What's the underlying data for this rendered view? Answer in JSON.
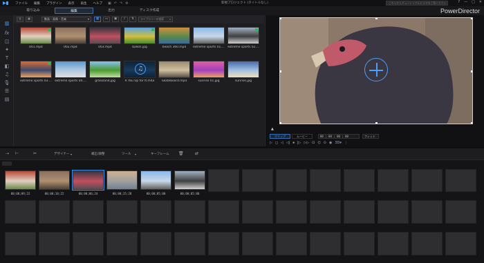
{
  "titlebar": {
    "menu": [
      "ファイル",
      "編集",
      "プラグイン",
      "表示",
      "再生",
      "ヘルプ"
    ],
    "project_title": "新規プロジェクト (タイトルなし)",
    "help_placeholder": "こちらからチュートリアルビデオをご覧ください",
    "window_buttons": [
      "?",
      "—",
      "□",
      "✕"
    ]
  },
  "modes": {
    "capture": "取り込み",
    "edit": "編集",
    "produce": "出力",
    "disc": "ディスク作成"
  },
  "brand": "PowerDirector",
  "library": {
    "dropdown": "動画・画像・音楽",
    "search_placeholder": "ライブラリーの検索",
    "items": [
      {
        "label": "001.mp4",
        "colors": [
          "#b84a3a",
          "#e0d0c0",
          "#6a8a4a"
        ],
        "checked": true
      },
      {
        "label": "002.mp4",
        "colors": [
          "#8a7060",
          "#b09070",
          "#4a4038"
        ],
        "checked": false
      },
      {
        "label": "003.mp4",
        "colors": [
          "#3a3440",
          "#c05060",
          "#5a4a50"
        ],
        "checked": false
      },
      {
        "label": "ballon.jpg",
        "colors": [
          "#5aa0e0",
          "#d0c040",
          "#4a8a30"
        ],
        "checked": true
      },
      {
        "label": "beach 360.mp4",
        "colors": [
          "#d09040",
          "#5a8a4a",
          "#3a6a9a"
        ],
        "checked": false
      },
      {
        "label": "extreme sports 01....",
        "colors": [
          "#8ab8e8",
          "#c8d8e8",
          "#606060"
        ],
        "checked": false
      },
      {
        "label": "extreme sports 02....",
        "colors": [
          "#a0b0c0",
          "#404040",
          "#d0d0d0"
        ],
        "checked": true
      },
      {
        "label": "extreme sports 03....",
        "colors": [
          "#e06a30",
          "#3a4a70",
          "#f0a060"
        ],
        "checked": true
      },
      {
        "label": "extreme sports 04....",
        "colors": [
          "#5a9ad0",
          "#b0c8e0",
          "#e0e0e0"
        ],
        "checked": false
      },
      {
        "label": "grassland.jpg",
        "colors": [
          "#8ac0f0",
          "#4a9a30",
          "#c0e0a0"
        ],
        "checked": false
      },
      {
        "label": "R You Up for It.m4a",
        "colors": [
          "#0d2236",
          "#1a3a5a",
          "#0d2236"
        ],
        "checked": false,
        "music": true
      },
      {
        "label": "Skateboard.mp4",
        "colors": [
          "#9a8a70",
          "#d0c0a0",
          "#5a5048"
        ],
        "checked": false
      },
      {
        "label": "sunrise 01.jpg",
        "colors": [
          "#e060a0",
          "#a040c0",
          "#f0a060"
        ],
        "checked": false
      },
      {
        "label": "sunrise.jpg",
        "colors": [
          "#4a6ab0",
          "#a0c0e0",
          "#f0e0c0"
        ],
        "checked": false
      }
    ]
  },
  "preview": {
    "clip_tab": "クリップ",
    "movie_tab": "ムービー",
    "timecode": "00 ; 00 ; 00 ; 00",
    "fit": "フィット",
    "controls": [
      "▷",
      "◻",
      "◁",
      "◁|",
      "⏹",
      "|▷",
      "▷▷",
      "⊡",
      "⌬",
      "⊙",
      "◉",
      "3D▾",
      "⋮"
    ]
  },
  "timeline_toolbar": {
    "designer": "デザイナー",
    "edit_correct": "補正/調整",
    "tools": "ツール",
    "keyframe": "キーフレーム"
  },
  "storyboard": {
    "clips": [
      {
        "time": "00;00;09;22",
        "colors": [
          "#b84a3a",
          "#e0d0c0",
          "#6a8a4a"
        ]
      },
      {
        "time": "00;00;10;22",
        "colors": [
          "#8a7060",
          "#b09070",
          "#4a4038"
        ]
      },
      {
        "time": "00;00;06;24",
        "colors": [
          "#3a3440",
          "#c05060",
          "#5a4a50"
        ],
        "selected": true
      },
      {
        "time": "00;00;15;28",
        "colors": [
          "#d0b090",
          "#a0a0a0",
          "#708090"
        ]
      },
      {
        "time": "00;00;05;00",
        "colors": [
          "#8ab8e8",
          "#c8d8e8",
          "#606060"
        ]
      },
      {
        "time": "00;00;05;00",
        "colors": [
          "#a0b0c0",
          "#404040",
          "#d0d0d0"
        ]
      }
    ]
  }
}
